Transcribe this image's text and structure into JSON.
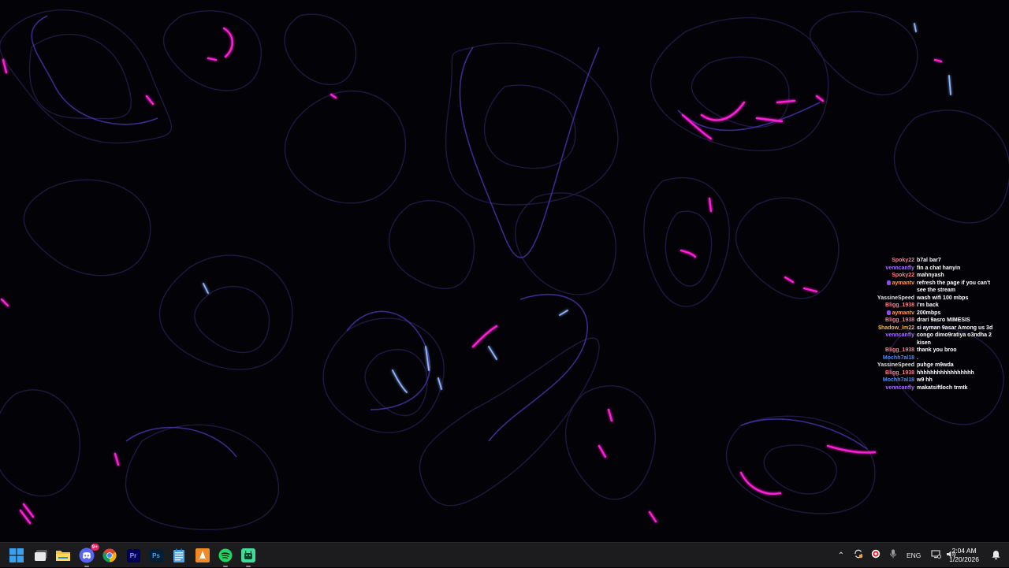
{
  "colors": {
    "wallpaper_background": "#030206",
    "contour_line": "#2a1f5a",
    "contour_glow": "#5a3fd0",
    "highlight_magenta": "#ff1fd8",
    "highlight_blue": "#7aa0ff",
    "taskbar_background": "#1c1c1e",
    "chat_text": "#ffffff"
  },
  "chat": {
    "messages": [
      {
        "user": "Spoky22",
        "user_color": "#ff7f8a",
        "text": "b7al bar7",
        "badge": false
      },
      {
        "user": "venncanfly",
        "user_color": "#a970ff",
        "text": "fin a chat hanyin",
        "badge": false
      },
      {
        "user": "Spoky22",
        "user_color": "#ff7f8a",
        "text": "mahnyash",
        "badge": false
      },
      {
        "user": "aymantv",
        "user_color": "#ff9f40",
        "text": "refresh the page if you can't see the stream",
        "badge": true
      },
      {
        "user": "YassineSpeed",
        "user_color": "#e0e0e0",
        "text": "wash wifi 100 mbps",
        "badge": false
      },
      {
        "user": "Bligg_1938",
        "user_color": "#ff7f8a",
        "text": "i'm back",
        "badge": false
      },
      {
        "user": "aymantv",
        "user_color": "#ff9f40",
        "text": "200mbps",
        "badge": true
      },
      {
        "user": "Bligg_1938",
        "user_color": "#ff7f8a",
        "text": "drari 9asro MIMESIS",
        "badge": false
      },
      {
        "user": "$hadow_lm22",
        "user_color": "#ffb347",
        "text": "si ayman 9asar Among us 3d",
        "badge": false
      },
      {
        "user": "venncanfly",
        "user_color": "#a970ff",
        "text": "congo dimo9ratiya o3ndha 2 kisen",
        "badge": false
      },
      {
        "user": "Bligg_1938",
        "user_color": "#ff7f8a",
        "text": "thank you broo",
        "badge": false
      },
      {
        "user": "Mochh7al18",
        "user_color": "#4f8bff",
        "text": ".",
        "badge": false
      },
      {
        "user": "YassineSpeed",
        "user_color": "#e0e0e0",
        "text": "puhge m9wda",
        "badge": false
      },
      {
        "user": "Bligg_1938",
        "user_color": "#ff7f8a",
        "text": "hhhhhhhhhhhhhhhhh",
        "badge": false
      },
      {
        "user": "Mochh7al18",
        "user_color": "#4f8bff",
        "text": "w9 hh",
        "badge": false
      },
      {
        "user": "venncanfly",
        "user_color": "#a970ff",
        "text": "makatsiftloch trmtk",
        "badge": false
      }
    ]
  },
  "taskbar": {
    "apps": [
      {
        "name": "start",
        "icon": "windows-start-icon"
      },
      {
        "name": "task-view",
        "icon": "task-view-icon"
      },
      {
        "name": "file-explorer",
        "icon": "folder-icon"
      },
      {
        "name": "discord",
        "icon": "discord-icon",
        "badge": "9+",
        "active": true
      },
      {
        "name": "chrome",
        "icon": "chrome-icon"
      },
      {
        "name": "premiere-pro",
        "icon": "premiere-pro-icon",
        "label": "Pr"
      },
      {
        "name": "photoshop",
        "icon": "photoshop-icon",
        "label": "Ps"
      },
      {
        "name": "notepad",
        "icon": "notepad-icon"
      },
      {
        "name": "vlc",
        "icon": "vlc-icon"
      },
      {
        "name": "spotify",
        "icon": "spotify-icon"
      },
      {
        "name": "android-app",
        "icon": "android-app-icon"
      }
    ],
    "tray": {
      "language": "ENG",
      "time": "2:04 AM",
      "date": "1/20/2026"
    }
  }
}
